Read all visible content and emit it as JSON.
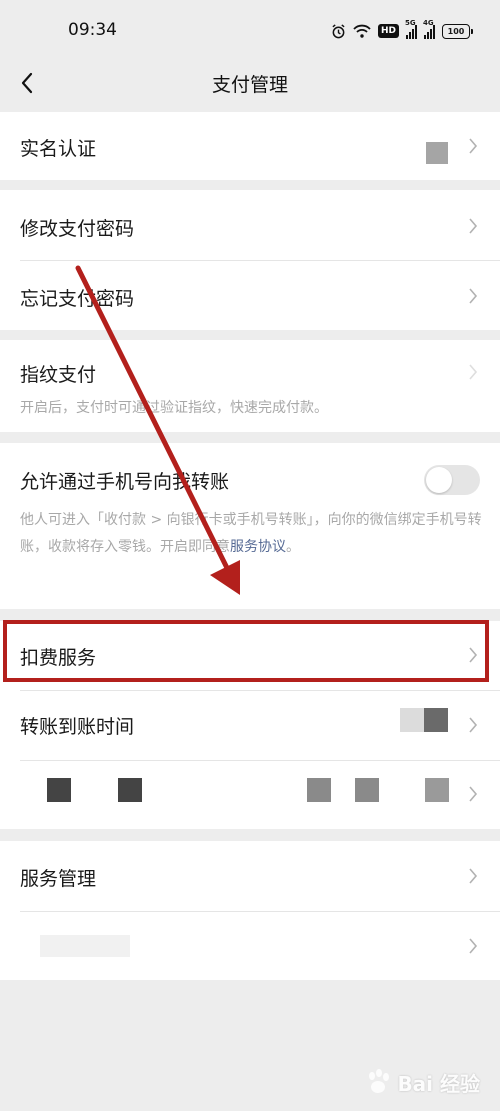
{
  "status_bar": {
    "time": "09:34",
    "hd": "HD",
    "sig1_tag": "5G",
    "sig2_tag": "4G",
    "battery": "100"
  },
  "nav": {
    "title": "支付管理"
  },
  "rows": {
    "realname": {
      "label": "实名认证"
    },
    "change_pwd": {
      "label": "修改支付密码"
    },
    "forgot_pwd": {
      "label": "忘记支付密码"
    },
    "fingerprint": {
      "label": "指纹支付",
      "desc": "开启后，支付时可通过验证指纹，快速完成付款。"
    },
    "phone_transfer": {
      "label": "允许通过手机号向我转账",
      "desc": "他人可进入「收付款 > 向银行卡或手机号转账」，向你的微信绑定手机号转账，收款将存入零钱。开启即同意",
      "desc_link": "服务协议",
      "desc_end": "。",
      "toggle_on": false
    },
    "deduction": {
      "label": "扣费服务"
    },
    "transfer_time": {
      "label": "转账到账时间"
    },
    "service_mgmt": {
      "label": "服务管理"
    }
  },
  "watermark": {
    "text": "Bai 经验"
  },
  "colors": {
    "accent_red": "#b3201c",
    "link": "#576b95",
    "page_bg": "#ededed"
  }
}
